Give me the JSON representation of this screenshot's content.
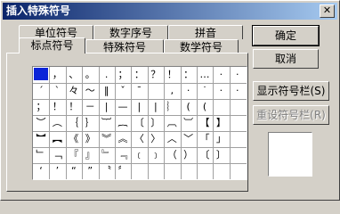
{
  "window": {
    "title": "插入特殊符号",
    "close": "✕"
  },
  "tabs_back": [
    "单位符号",
    "数字序号",
    "拼音"
  ],
  "tabs_front": [
    "标点符号",
    "特殊符号",
    "数学符号"
  ],
  "buttons": {
    "ok": "确定",
    "cancel": "取消",
    "show_bar": "显示符号栏(S)",
    "reset_bar": "重设符号栏(R)"
  },
  "grid": [
    [
      "",
      "，",
      "、",
      "。",
      ".",
      "；",
      "：",
      "？",
      "！",
      "：",
      "…",
      "·",
      "·"
    ],
    [
      "ˊ",
      "ˋ",
      "々",
      "～",
      "‖",
      "ˇ",
      "ˉ",
      "",
      "‚",
      "·",
      "˙",
      "·",
      "·"
    ],
    [
      "；",
      "！",
      "！",
      "－",
      "|",
      "—",
      "|",
      "|",
      "︴",
      "(",
      "(",
      "",
      ""
    ],
    [
      "︶",
      "︵",
      "｛",
      "｝",
      "︸",
      "︷",
      "〔",
      "〕",
      "︹",
      "︺",
      "【",
      "】",
      ""
    ],
    [
      "︼",
      "︻",
      "《",
      "》",
      "︾",
      "︽",
      "〈",
      "〉",
      "︿",
      "﹀",
      "「",
      "」",
      ""
    ],
    [
      "﹂",
      "﹁",
      "『",
      "』",
      "﹄",
      "﹃",
      "﹝",
      "﹞",
      "（",
      "）",
      "〔",
      "〕",
      ""
    ],
    [
      "‘",
      "’",
      "“",
      "”",
      "〝",
      "〞",
      "",
      "",
      "",
      "",
      "",
      "",
      ""
    ]
  ]
}
